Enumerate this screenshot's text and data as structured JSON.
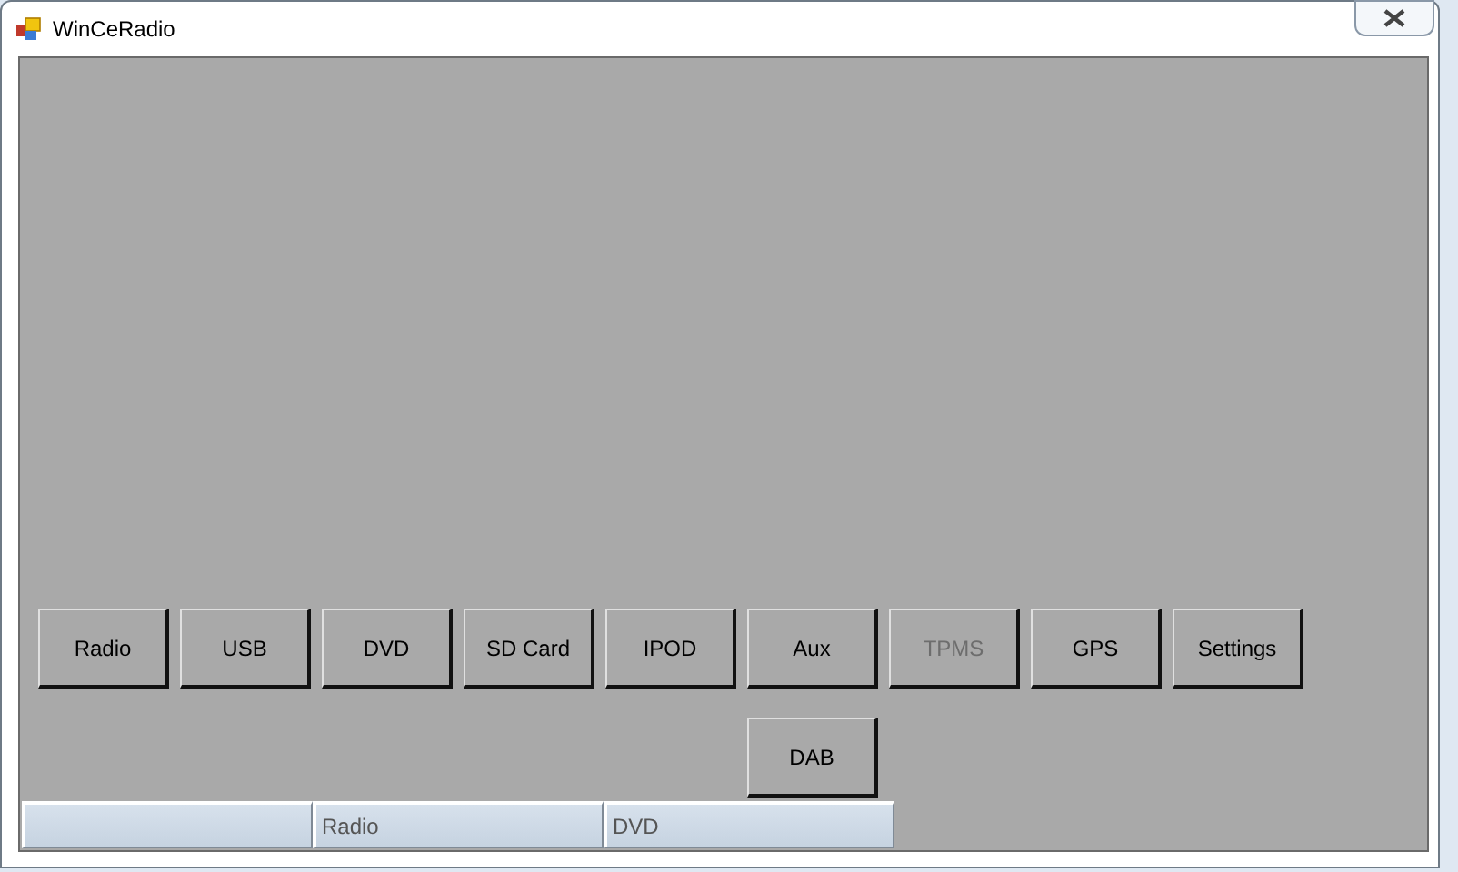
{
  "window": {
    "title": "WinCeRadio"
  },
  "buttons": [
    {
      "label": "Radio",
      "disabled": false
    },
    {
      "label": "USB",
      "disabled": false
    },
    {
      "label": "DVD",
      "disabled": false
    },
    {
      "label": "SD Card",
      "disabled": false
    },
    {
      "label": "IPOD",
      "disabled": false
    },
    {
      "label": "Aux",
      "disabled": false
    },
    {
      "label": "TPMS",
      "disabled": true
    },
    {
      "label": "GPS",
      "disabled": false
    },
    {
      "label": "Settings",
      "disabled": false
    }
  ],
  "second_row_buttons": [
    {
      "label": "DAB",
      "disabled": false
    }
  ],
  "status_bar": {
    "panels": [
      {
        "kind": "blank"
      },
      {
        "kind": "text",
        "text": "Radio"
      },
      {
        "kind": "text",
        "text": "DVD"
      }
    ]
  }
}
